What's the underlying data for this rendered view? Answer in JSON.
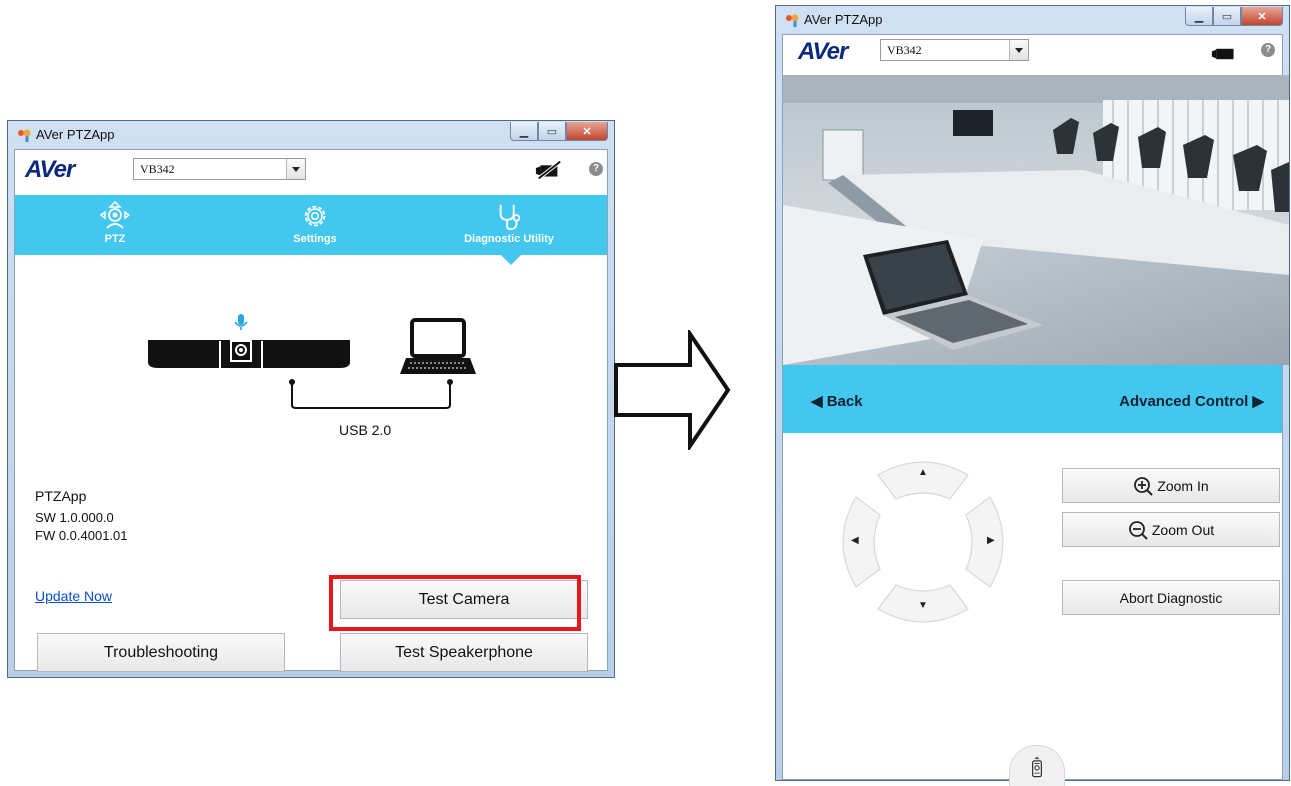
{
  "left_window": {
    "title": "AVer PTZApp",
    "logo": "AVer",
    "camera_select": "VB342",
    "help_label": "?",
    "nav": [
      {
        "label": "PTZ",
        "icon": "ptz-icon"
      },
      {
        "label": "Settings",
        "icon": "gear-icon"
      },
      {
        "label": "Diagnostic Utility",
        "icon": "stethoscope-icon",
        "active": true
      }
    ],
    "diagram": {
      "connection_label": "USB 2.0"
    },
    "info": {
      "app_name": "PTZApp",
      "sw": "SW 1.0.000.0",
      "fw": "FW 0.0.4001.01"
    },
    "update_link": "Update Now",
    "buttons": {
      "test_camera": "Test Camera",
      "troubleshooting": "Troubleshooting",
      "test_speakerphone": "Test Speakerphone"
    },
    "highlight_color": "#e8171b"
  },
  "right_window": {
    "title": "AVer PTZApp",
    "logo": "AVer",
    "camera_select": "VB342",
    "help_label": "?",
    "control_bar": {
      "back": "◀ Back",
      "advanced": "Advanced Control ▶"
    },
    "buttons": {
      "zoom_in": "Zoom In",
      "zoom_out": "Zoom Out",
      "abort": "Abort Diagnostic"
    },
    "dpad": {
      "up": "▲",
      "down": "▼",
      "left": "◀",
      "right": "▶"
    }
  },
  "colors": {
    "accent": "#44c7ee",
    "logo": "#0d2a7a",
    "link": "#0b4fc9"
  }
}
